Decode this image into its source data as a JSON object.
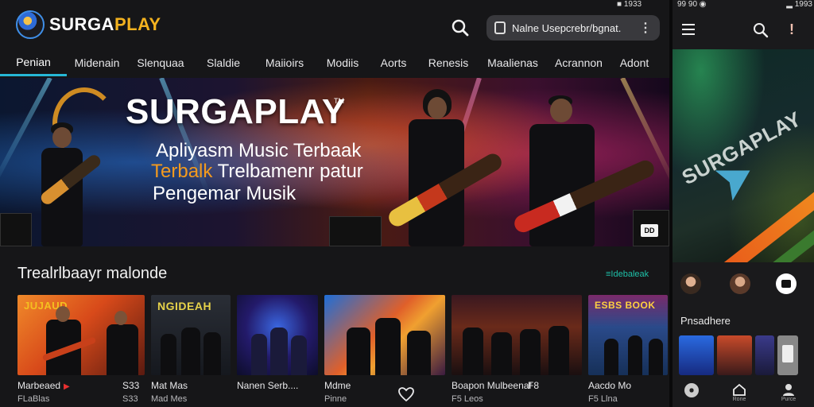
{
  "app": {
    "name_part1": "SURGA",
    "name_part2": "PLAY"
  },
  "header": {
    "login_label": "Nalne Usepcrebr/bgnat.",
    "more_icon": "more-vertical-icon",
    "search_icon": "search-icon"
  },
  "statusbar_main": {
    "text": "■ 1933"
  },
  "nav": {
    "items": [
      {
        "label": "Penian",
        "active": true
      },
      {
        "label": "Midenain",
        "active": false
      },
      {
        "label": "Slenquaa",
        "active": false
      },
      {
        "label": "Slaldie",
        "active": false
      },
      {
        "label": "Maiioirs",
        "active": false
      },
      {
        "label": "Modiis",
        "active": false
      },
      {
        "label": "Aorts",
        "active": false
      },
      {
        "label": "Renesis",
        "active": false
      },
      {
        "label": "Maalienas",
        "active": false
      },
      {
        "label": "Acrannon",
        "active": false
      },
      {
        "label": "Adont",
        "active": false
      }
    ],
    "accent_color": "#26b7d6"
  },
  "hero": {
    "title": "SURGAPLAY",
    "tm": "TM",
    "line1": "Apliyasm Music Terbaak",
    "line2_orange": "Terbalk",
    "line2_rest": " Trelbamenr patur",
    "line3": "Pengemar Musik",
    "corner_icon": "DD"
  },
  "section": {
    "title": "Trealrlbaayr malonde",
    "link": "≡Idebaleak"
  },
  "cards": [
    {
      "badge": "JUJAUD",
      "title": "Marbeaed",
      "sub": "FLaBlas",
      "time": "S33",
      "time2": "S33",
      "has_play": true
    },
    {
      "badge": "NGIDEAH",
      "title": "Mat Mas",
      "sub": "Mad Mes",
      "time": "",
      "time2": "",
      "has_play": false
    },
    {
      "badge": "",
      "title": "Nanen Serb....",
      "sub": "",
      "time": "",
      "time2": "",
      "has_play": false
    },
    {
      "badge": "",
      "title": "Mdme",
      "sub": "Pinne",
      "time": "",
      "time2": "",
      "has_play": false
    },
    {
      "badge": "",
      "title": "Boapon Mulbeenaf",
      "sub": "F5 Leos",
      "time": "F8",
      "time2": "",
      "has_play": false
    },
    {
      "badge": "ESBS BOOK",
      "title": "Aacdo Mo",
      "sub": "F5 Llna",
      "time": "",
      "time2": "",
      "has_play": false
    }
  ],
  "phone": {
    "status_left": "99 90 ◉",
    "status_right": "▂ 1993",
    "brand": "SURGAPLAY",
    "label": "Pnsadhere",
    "tabs": [
      {
        "icon": "disc-icon",
        "label": ""
      },
      {
        "icon": "home-icon",
        "label": "Rone"
      },
      {
        "icon": "profile-icon",
        "label": "Purce"
      }
    ],
    "play_icon": "play-badge-icon"
  }
}
